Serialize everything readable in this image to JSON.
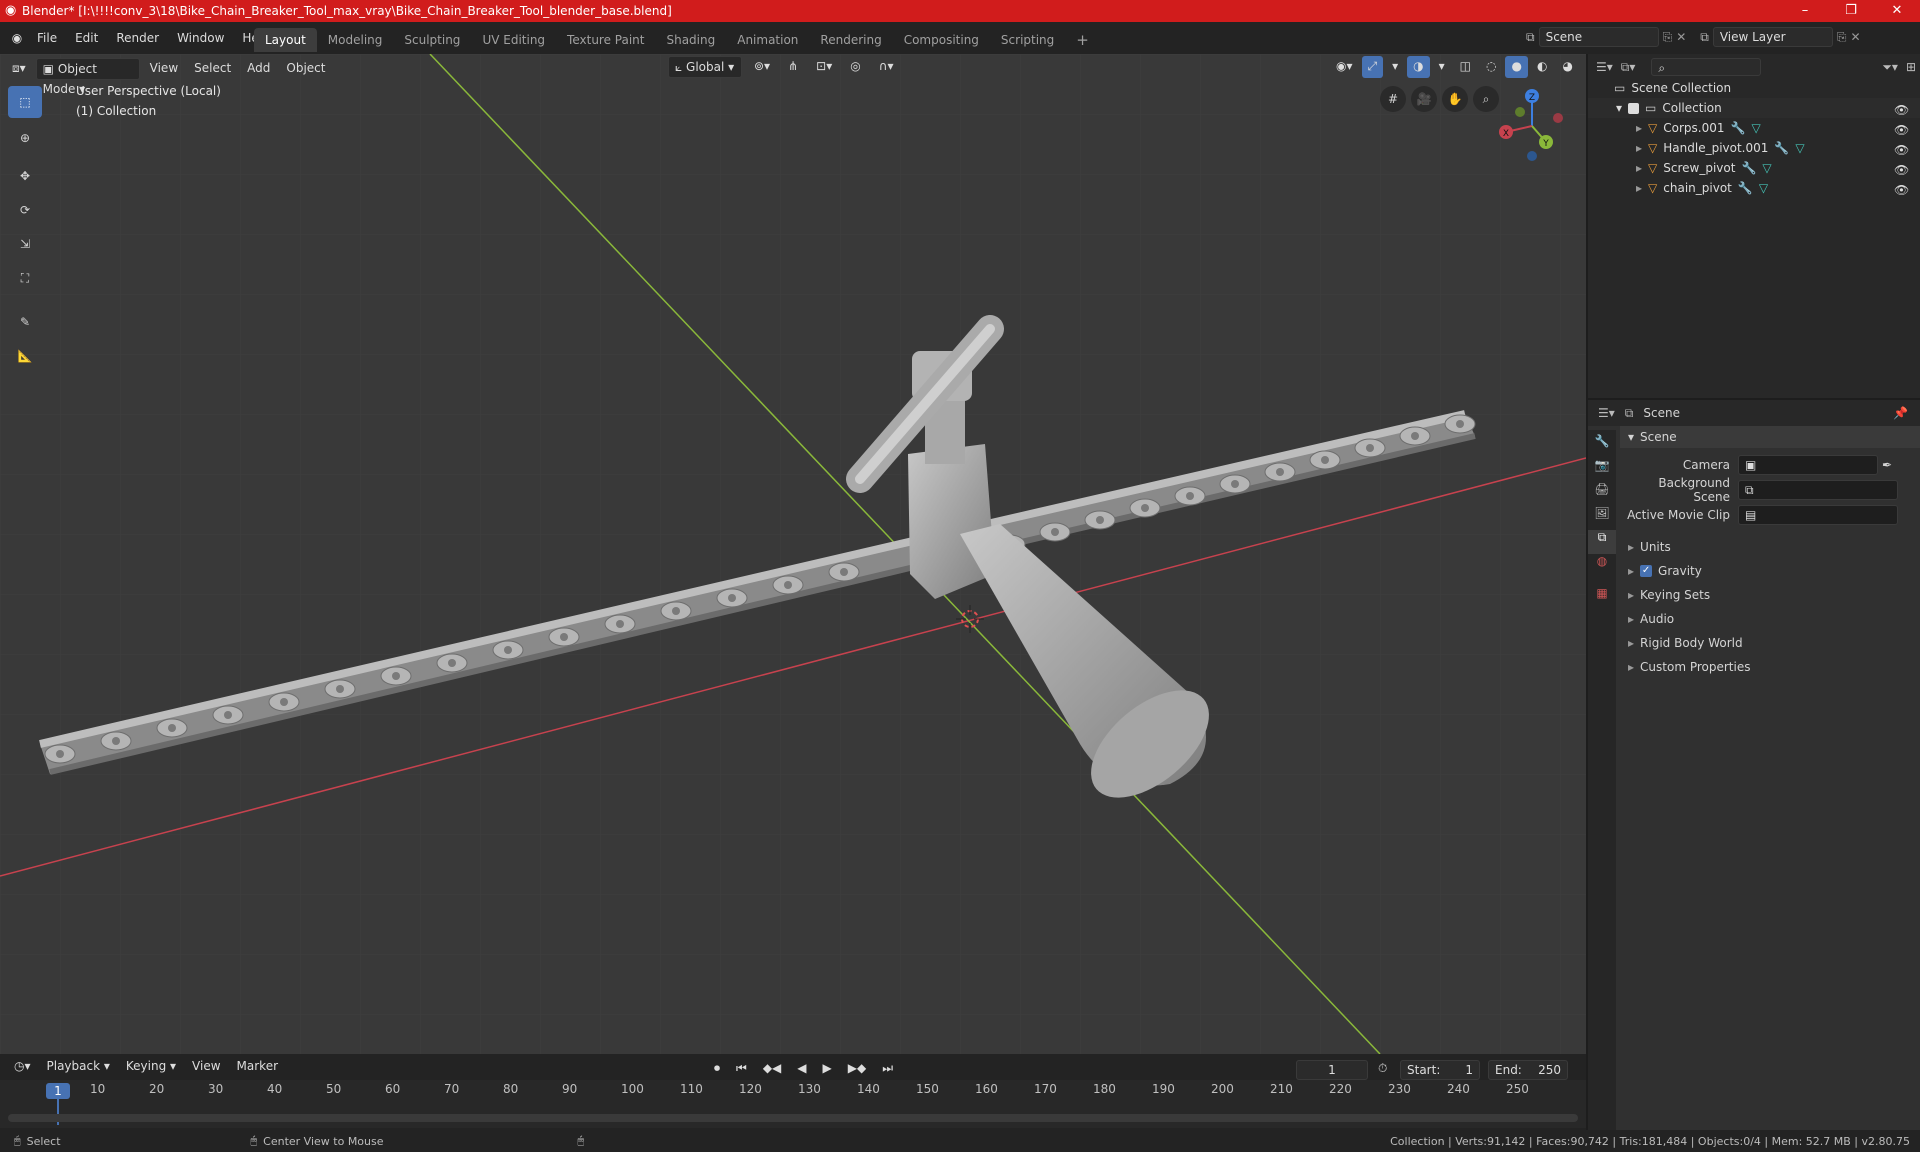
{
  "window": {
    "title": "Blender* [I:\\!!!!conv_3\\18\\Bike_Chain_Breaker_Tool_max_vray\\Bike_Chain_Breaker_Tool_blender_base.blend]",
    "controls": [
      "–",
      "❐",
      "✕"
    ],
    "title_color": "#d11c1c"
  },
  "menubar": {
    "menus": [
      "File",
      "Edit",
      "Render",
      "Window",
      "Help"
    ],
    "workspaces": [
      "Layout",
      "Modeling",
      "Sculpting",
      "UV Editing",
      "Texture Paint",
      "Shading",
      "Animation",
      "Rendering",
      "Compositing",
      "Scripting"
    ],
    "active_workspace": "Layout",
    "add_tab": "+",
    "scene_value": "Scene",
    "view_layer_value": "View Layer"
  },
  "viewport": {
    "mode": "Object Mode",
    "menus": [
      "View",
      "Select",
      "Add",
      "Object"
    ],
    "transform_orientation": "Global",
    "overlay_title": "User Perspective (Local)",
    "overlay_collection": "(1) Collection",
    "gizmo_axes": {
      "x": "X",
      "y": "Y",
      "z": "Z"
    },
    "tools": [
      "select-box",
      "cursor",
      "move",
      "rotate",
      "scale",
      "transform",
      "annotate",
      "measure"
    ],
    "colors": {
      "x_axis": "#c7424e",
      "y_axis": "#8ab83a",
      "z_axis": "#3d7fe0",
      "bg": "#393939"
    }
  },
  "outliner": {
    "search_placeholder": "",
    "root": "Scene Collection",
    "collection": "Collection",
    "objects": [
      "Corps.001",
      "Handle_pivot.001",
      "Screw_pivot",
      "chain_pivot"
    ]
  },
  "properties": {
    "header_title": "Scene",
    "panel_title": "Scene",
    "fields": [
      {
        "label": "Camera",
        "value": ""
      },
      {
        "label": "Background Scene",
        "value": ""
      },
      {
        "label": "Active Movie Clip",
        "value": ""
      }
    ],
    "sections": [
      "Units",
      "Gravity",
      "Keying Sets",
      "Audio",
      "Rigid Body World",
      "Custom Properties"
    ],
    "gravity_checked": true
  },
  "timeline": {
    "menus": [
      "Playback",
      "Keying",
      "View",
      "Marker"
    ],
    "current_frame": "1",
    "start_label": "Start:",
    "start_value": "1",
    "end_label": "End:",
    "end_value": "250",
    "ruler_current": "1",
    "ruler": [
      "10",
      "20",
      "30",
      "40",
      "50",
      "60",
      "70",
      "80",
      "90",
      "100",
      "110",
      "120",
      "130",
      "140",
      "150",
      "160",
      "170",
      "180",
      "190",
      "200",
      "210",
      "220",
      "230",
      "240",
      "250"
    ]
  },
  "statusbar": {
    "left_action": "Select",
    "middle_action": "Center View to Mouse",
    "stats": "Collection | Verts:91,142 | Faces:90,742 | Tris:181,484 | Objects:0/4 | Mem: 52.7 MB | v2.80.75"
  }
}
